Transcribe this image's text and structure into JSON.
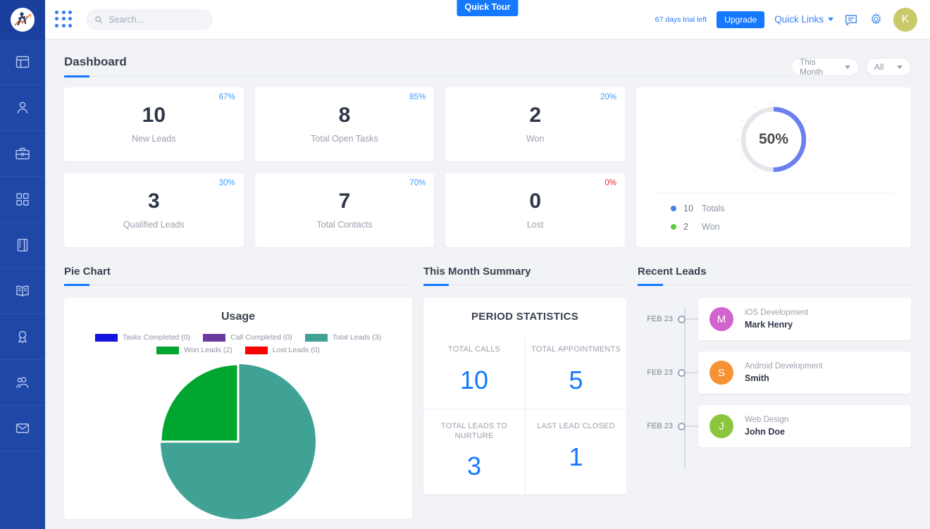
{
  "brand": {
    "logo_name": "running-figure-logo",
    "sidebar_bg": "#1f47a8",
    "accent": "#1479ff"
  },
  "topbar": {
    "apps_icon": "grid-apps-icon",
    "search": {
      "value": "",
      "placeholder": "Search..."
    },
    "quick_tour": "Quick Tour",
    "trial": "67 days trial left",
    "upgrade": "Upgrade",
    "quick_links": "Quick Links",
    "chat_icon": "chat-bubble-icon",
    "settings_icon": "gear-icon",
    "avatar_initial": "K",
    "avatar_color": "#c8ca6a"
  },
  "sidebar": {
    "items": [
      {
        "name": "dashboard",
        "icon": "layout-dashboard-icon"
      },
      {
        "name": "contacts",
        "icon": "person-icon"
      },
      {
        "name": "deals",
        "icon": "briefcase-icon"
      },
      {
        "name": "apps",
        "icon": "grid-squares-icon"
      },
      {
        "name": "notebook",
        "icon": "notebook-icon"
      },
      {
        "name": "library",
        "icon": "open-book-icon"
      },
      {
        "name": "awards",
        "icon": "award-ribbon-icon"
      },
      {
        "name": "teams",
        "icon": "users-group-icon"
      },
      {
        "name": "mail",
        "icon": "envelope-icon"
      }
    ]
  },
  "page": {
    "title": "Dashboard",
    "filters": [
      {
        "label": "This Month",
        "name": "period-filter"
      },
      {
        "label": "All",
        "name": "scope-filter"
      }
    ]
  },
  "kpis": [
    {
      "value": "10",
      "label": "New Leads",
      "pct": "67%",
      "pct_color": "blue"
    },
    {
      "value": "8",
      "label": "Total Open Tasks",
      "pct": "85%",
      "pct_color": "blue"
    },
    {
      "value": "2",
      "label": "Won",
      "pct": "20%",
      "pct_color": "blue"
    },
    {
      "value": "3",
      "label": "Qualified Leads",
      "pct": "30%",
      "pct_color": "blue"
    },
    {
      "value": "7",
      "label": "Total Contacts",
      "pct": "70%",
      "pct_color": "blue"
    },
    {
      "value": "0",
      "label": "Lost",
      "pct": "0%",
      "pct_color": "red"
    }
  ],
  "donut": {
    "center_label": "50%",
    "legend": [
      {
        "value": "10",
        "label": "Totals",
        "color": "#4b7bec"
      },
      {
        "value": "2",
        "label": "Won",
        "color": "#5ec83f"
      }
    ]
  },
  "sections": {
    "pie_chart": "Pie Chart",
    "month_summary": "This Month Summary",
    "recent_leads": "Recent Leads"
  },
  "period_stats": {
    "title": "PERIOD STATISTICS",
    "cells": [
      {
        "label": "TOTAL CALLS",
        "value": "10"
      },
      {
        "label": "TOTAL APPOINTMENTS",
        "value": "5"
      },
      {
        "label": "TOTAL LEADS TO NURTURE",
        "value": "3"
      },
      {
        "label": "LAST LEAD CLOSED",
        "value": "1"
      }
    ]
  },
  "recent_leads": [
    {
      "date": "FEB 23",
      "initial": "M",
      "role": "iOS Development",
      "name": "Mark Henry",
      "color": "#d063cd"
    },
    {
      "date": "FEB 23",
      "initial": "S",
      "role": "Android Development",
      "name": "Smith",
      "color": "#f79234"
    },
    {
      "date": "FEB 23",
      "initial": "J",
      "role": "Web Design",
      "name": "John Doe",
      "color": "#8cc63e"
    }
  ],
  "chart_data": [
    {
      "type": "donut",
      "title": "",
      "center_text": "50%",
      "categories": [
        "Totals",
        "Won"
      ],
      "values": [
        10,
        2
      ],
      "percent_filled": 50,
      "colors": [
        "#4b7bec",
        "#5ec83f"
      ],
      "track_color": "#e3e6ea",
      "legend_position": "bottom-left"
    },
    {
      "type": "pie",
      "title": "Usage",
      "categories": [
        "Tasks Completed",
        "Call Completed",
        "Total Leads",
        "Won Leads",
        "Lost Leads"
      ],
      "values": [
        0,
        0,
        3,
        2,
        0
      ],
      "labels": [
        "Tasks Completed (0)",
        "Call Completed (0)",
        "Total Leads (3)",
        "Won Leads (2)",
        "Lost Leads (0)"
      ],
      "colors": [
        "#1414e0",
        "#6a3a9e",
        "#3fa294",
        "#00a630",
        "#ff0000"
      ],
      "legend_position": "top",
      "start_angle": 0
    }
  ]
}
